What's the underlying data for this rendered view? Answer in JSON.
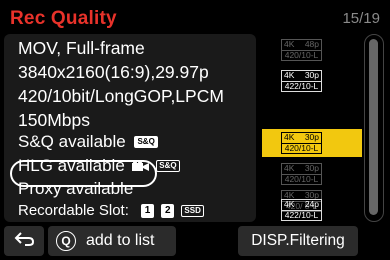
{
  "header": {
    "title": "Rec Quality",
    "page_indicator": "15/19"
  },
  "details": {
    "file_format": "MOV, Full-frame",
    "resolution": "3840x2160(16:9),29.97p",
    "codec": "420/10bit/LongGOP,LPCM",
    "bitrate": "150Mbps",
    "sq_available": "S&Q available",
    "sq_badge": "S&Q",
    "hlg_available": "HLG available",
    "hlg_badge": "S&Q",
    "proxy_available": "Proxy available",
    "recordable_slot_label": "Recordable Slot:",
    "slot_1": "1",
    "slot_2": "2",
    "slot_sd": "SSD"
  },
  "formats": [
    {
      "res": "4K",
      "fps": "48p",
      "spec": "420/10-L",
      "state": "dim"
    },
    {
      "res": "4K",
      "fps": "30p",
      "spec": "422/10-L",
      "state": "normal"
    },
    {
      "res": "4K",
      "fps": "30p",
      "spec": "420/10-L",
      "state": "selected"
    },
    {
      "res": "4K",
      "fps": "30p",
      "spec": "420/10-L",
      "state": "dim"
    },
    {
      "res": "4K",
      "fps": "30p",
      "spec": "420/ 8-L",
      "state": "dim"
    },
    {
      "res": "4K",
      "fps": "24p",
      "spec": "422/10-L",
      "state": "normal"
    }
  ],
  "buttons": {
    "add_label": "add to list",
    "add_key": "Q",
    "filter_label": "DISP.Filtering"
  },
  "colors": {
    "title": "#e8322a",
    "selection": "#f2c80f"
  }
}
